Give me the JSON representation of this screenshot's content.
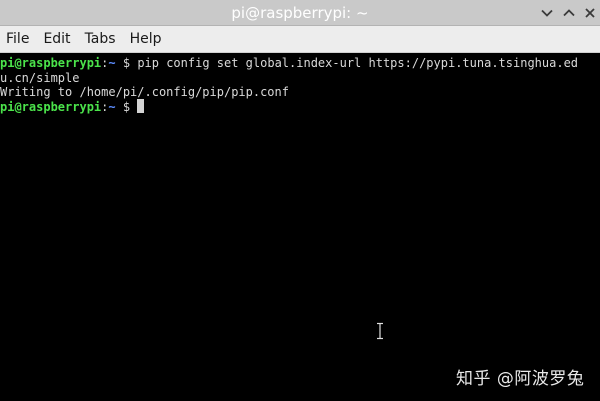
{
  "window": {
    "title": "pi@raspberrypi: ~"
  },
  "titlebar_buttons": {
    "minimize_icon": "chevron-down-icon",
    "maximize_icon": "chevron-up-icon",
    "close_icon": "close-icon"
  },
  "menu": {
    "items": [
      "File",
      "Edit",
      "Tabs",
      "Help"
    ]
  },
  "terminal": {
    "line1": {
      "user": "pi@raspberrypi",
      "sep": ":",
      "path": "~",
      "sign": " $ ",
      "command": "pip config set global.index-url https://pypi.tuna.tsinghua.ed"
    },
    "line2": "u.cn/simple",
    "line3": "Writing to /home/pi/.config/pip/pip.conf",
    "line4": {
      "user": "pi@raspberrypi",
      "sep": ":",
      "path": "~",
      "sign": " $ "
    }
  },
  "watermark": {
    "text": "知乎 @阿波罗兔"
  },
  "colors": {
    "titlebar_bg": "#c9c9c9",
    "menubar_bg": "#ededed",
    "terminal_bg": "#000000",
    "prompt_user": "#4be34b",
    "prompt_path": "#5c8dff",
    "text": "#d9d9d9"
  }
}
